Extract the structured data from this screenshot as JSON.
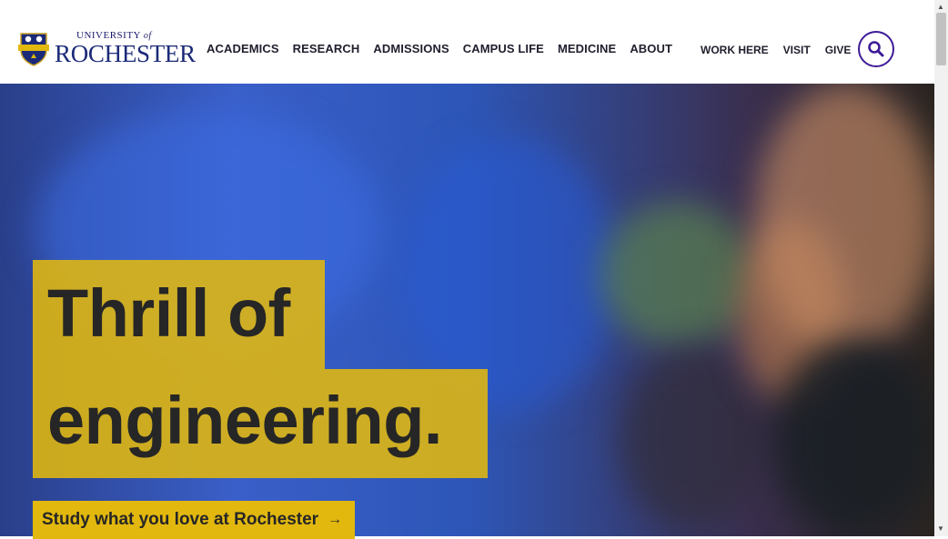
{
  "header": {
    "logo": {
      "university_label": "UNIVERSITY",
      "of_label": "of",
      "name_label": "ROCHESTER"
    },
    "nav": [
      {
        "label": "ACADEMICS"
      },
      {
        "label": "RESEARCH"
      },
      {
        "label": "ADMISSIONS"
      },
      {
        "label": "CAMPUS LIFE"
      },
      {
        "label": "MEDICINE"
      },
      {
        "label": "ABOUT"
      }
    ],
    "utility": [
      {
        "label": "WORK HERE"
      },
      {
        "label": "VISIT"
      },
      {
        "label": "GIVE"
      }
    ],
    "search_icon": "search-icon"
  },
  "hero": {
    "headline_line1": "Thrill of",
    "headline_line2": "engineering.",
    "cta_label": "Study what you love at Rochester",
    "cta_arrow": "→"
  },
  "colors": {
    "brand_blue": "#1b2a78",
    "accent_purple": "#3d1b96",
    "accent_yellow": "#e2b80e",
    "text_dark": "#262626"
  }
}
